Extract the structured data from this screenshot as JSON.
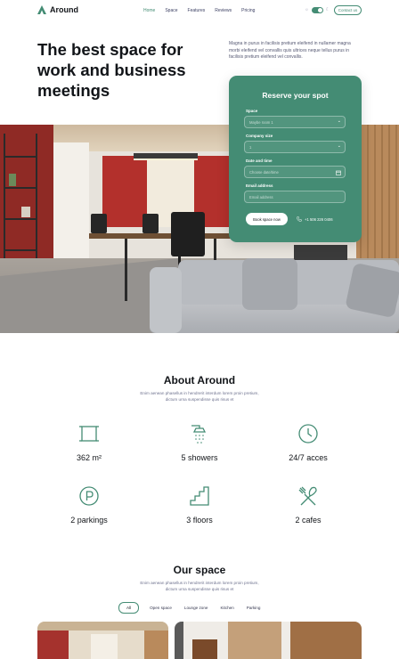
{
  "brand": {
    "name": "Around",
    "accent": "#448c74"
  },
  "nav": {
    "items": [
      {
        "label": "Home",
        "active": true
      },
      {
        "label": "Space",
        "active": false
      },
      {
        "label": "Features",
        "active": false
      },
      {
        "label": "Reviews",
        "active": false
      },
      {
        "label": "Pricing",
        "active": false
      }
    ],
    "mode_light": "☼",
    "mode_dark": "☾",
    "contact_label": "Contact us"
  },
  "hero": {
    "title": "The best space for work and business meetings",
    "description": "Magna in purus in facilisis pretium eleifend in nullamer magna morbi eleifend vel convallis quis ultrices neque tellus purus in facilisis pretium eleifend vel convallis."
  },
  "reserve": {
    "title": "Reserve your spot",
    "space_label": "Space",
    "space_placeholder": "Maybe room 1",
    "size_label": "Company size",
    "size_value": "1",
    "date_label": "Date and time",
    "date_placeholder": "Choose date/time",
    "email_label": "Email address",
    "email_placeholder": "Email address",
    "book_label": "Book space now",
    "phone": "+1 506 226 0406"
  },
  "about": {
    "title": "About Around",
    "description": "Enim aenean phasellus in hendrerit interdum lorem proin pretium, dictum urna suspendisse quis risus et",
    "stats": [
      {
        "icon": "area-icon",
        "label": "362 m²"
      },
      {
        "icon": "shower-icon",
        "label": "5 showers"
      },
      {
        "icon": "clock-icon",
        "label": "24/7 acces"
      },
      {
        "icon": "parking-icon",
        "label": "2 parkings"
      },
      {
        "icon": "stairs-icon",
        "label": "3 floors"
      },
      {
        "icon": "cutlery-icon",
        "label": "2 cafes"
      }
    ]
  },
  "our_space": {
    "title": "Our space",
    "description": "Enim aenean phasellus in hendrerit interdum lorem proin pretium, dictum urna suspendisse quis risus et",
    "filters": [
      {
        "label": "All",
        "active": true
      },
      {
        "label": "Open space",
        "active": false
      },
      {
        "label": "Lounge zone",
        "active": false
      },
      {
        "label": "Kitchen",
        "active": false
      },
      {
        "label": "Parking",
        "active": false
      }
    ]
  }
}
